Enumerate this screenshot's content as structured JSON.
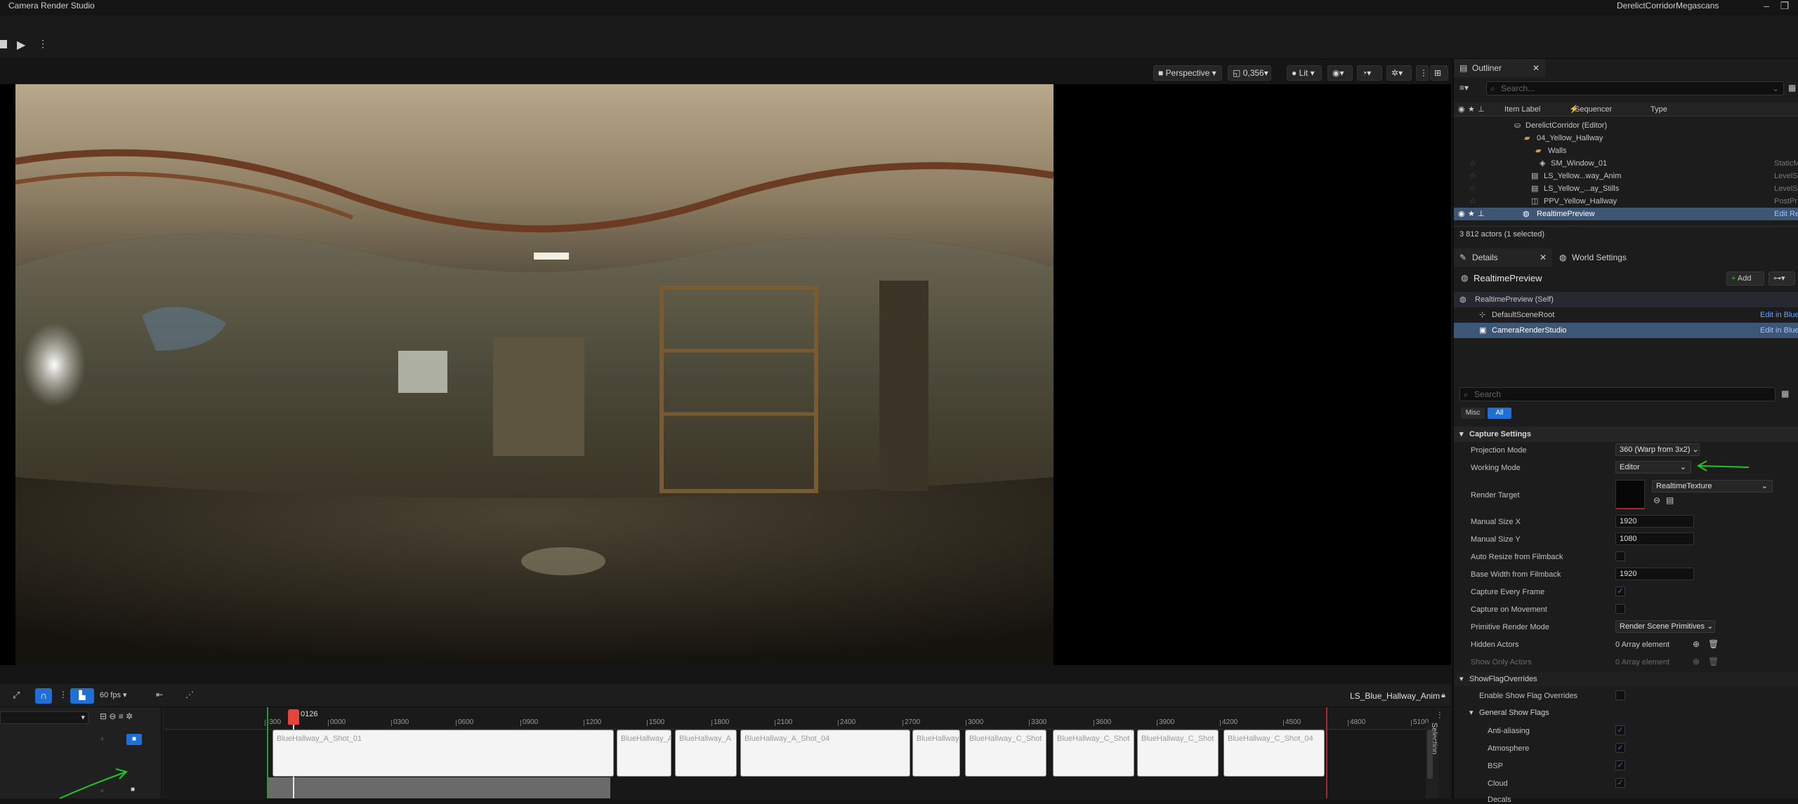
{
  "window": {
    "app_title": "Camera Render Studio",
    "project": "DerelictCorridorMegascans",
    "min": "–",
    "max": "❐"
  },
  "viewport": {
    "perspective_label": "Perspective",
    "fov_label": "0,356",
    "lit_label": "Lit"
  },
  "sequencer": {
    "fps_label": "60 fps",
    "playhead_frame": "0126",
    "sequence_name": "LS_Blue_Hallway_Anim",
    "selection_tab": "Selection",
    "ticks": [
      "-300",
      "0000",
      "0300",
      "0600",
      "0900",
      "1200",
      "1500",
      "1800",
      "2100",
      "2400",
      "2700",
      "3000",
      "3300",
      "3600",
      "3900",
      "4200",
      "4500",
      "4800",
      "5100"
    ],
    "clips": [
      {
        "label": "BlueHallway_A_Shot_01"
      },
      {
        "label": "BlueHallway_A"
      },
      {
        "label": "BlueHallway_A"
      },
      {
        "label": "BlueHallway_A_Shot_04"
      },
      {
        "label": "BlueHallway"
      },
      {
        "label": "BlueHallway_C_Shot"
      },
      {
        "label": "BlueHallway_C_Shot"
      },
      {
        "label": "BlueHallway_C_Shot"
      },
      {
        "label": "BlueHallway_C_Shot_04"
      }
    ]
  },
  "outliner": {
    "tab": "Outliner",
    "search_placeholder": "Search...",
    "col_label": "Item Label",
    "col_sequencer": "Sequencer",
    "col_type": "Type",
    "items": [
      {
        "label": "DerelictCorridor (Editor)",
        "type": ""
      },
      {
        "label": "04_Yellow_Hallway",
        "type": ""
      },
      {
        "label": "Walls",
        "type": ""
      },
      {
        "label": "SM_Window_01",
        "type": "StaticM"
      },
      {
        "label": "LS_Yellow...way_Anim",
        "type": "LevelS"
      },
      {
        "label": "LS_Yellow_...ay_Stills",
        "type": "LevelS"
      },
      {
        "label": "PPV_Yellow_Hallway",
        "type": "PostPr"
      },
      {
        "label": "RealtimePreview",
        "type": "Edit Re"
      }
    ],
    "status": "3 812 actors (1 selected)"
  },
  "details": {
    "tab": "Details",
    "world_settings_tab": "World Settings",
    "actor_name": "RealtimePreview",
    "add_label": "Add",
    "components": [
      {
        "label": "RealtimePreview (Self)",
        "edit": ""
      },
      {
        "label": "DefaultSceneRoot",
        "edit": "Edit in Bluep"
      },
      {
        "label": "CameraRenderStudio",
        "edit": "Edit in Bluep"
      }
    ],
    "search_placeholder": "Search",
    "filter_misc": "Misc",
    "filter_all": "All",
    "section_capture": "Capture Settings",
    "props": {
      "projection_mode": {
        "label": "Projection Mode",
        "value": "360 (Warp from 3x2)"
      },
      "working_mode": {
        "label": "Working Mode",
        "value": "Editor"
      },
      "render_target": {
        "label": "Render Target",
        "value": "RealtimeTexture"
      },
      "manual_x": {
        "label": "Manual Size X",
        "value": "1920"
      },
      "manual_y": {
        "label": "Manual Size Y",
        "value": "1080"
      },
      "auto_resize": {
        "label": "Auto Resize from Filmback"
      },
      "base_width": {
        "label": "Base Width from Filmback",
        "value": "1920"
      },
      "capture_every": {
        "label": "Capture Every Frame"
      },
      "capture_move": {
        "label": "Capture on Movement"
      },
      "primitive_mode": {
        "label": "Primitive Render Mode",
        "value": "Render Scene Primitives"
      },
      "hidden_actors": {
        "label": "Hidden Actors",
        "value": "0 Array element"
      },
      "show_only": {
        "label": "Show Only Actors",
        "value": "0 Array element"
      }
    },
    "section_showflag": "ShowFlagOverrides",
    "enable_show_flag": "Enable Show Flag Overrides",
    "general_show_flags": "General Show Flags",
    "flags": [
      "Anti-aliasing",
      "Atmosphere",
      "BSP",
      "Cloud",
      "Decals"
    ]
  },
  "colors": {
    "accent": "#2f7ff0",
    "selection": "#3e5676",
    "playhead": "#e5443a",
    "annotation": "#25c425"
  }
}
